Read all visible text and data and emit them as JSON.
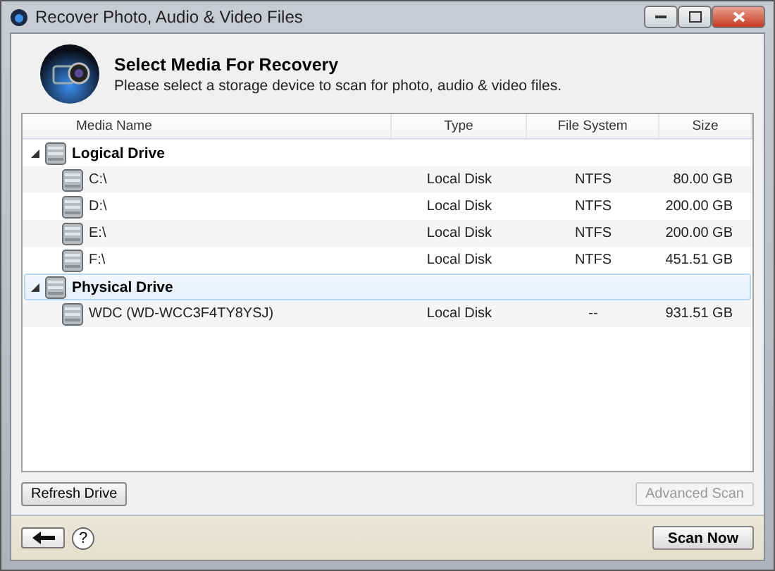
{
  "window": {
    "title": "Recover Photo, Audio & Video Files"
  },
  "header": {
    "title": "Select Media For Recovery",
    "subtitle": "Please select a storage device to scan for photo, audio & video files."
  },
  "table": {
    "columns": [
      "Media Name",
      "Type",
      "File System",
      "Size"
    ],
    "groups": [
      {
        "name": "Logical Drive",
        "expanded": true,
        "selected": false,
        "children": [
          {
            "name": "C:\\",
            "type": "Local Disk",
            "file_system": "NTFS",
            "size": "80.00 GB"
          },
          {
            "name": "D:\\",
            "type": "Local Disk",
            "file_system": "NTFS",
            "size": "200.00 GB"
          },
          {
            "name": "E:\\",
            "type": "Local Disk",
            "file_system": "NTFS",
            "size": "200.00 GB"
          },
          {
            "name": "F:\\",
            "type": "Local Disk",
            "file_system": "NTFS",
            "size": "451.51 GB"
          }
        ]
      },
      {
        "name": "Physical Drive",
        "expanded": true,
        "selected": true,
        "children": [
          {
            "name": "WDC (WD-WCC3F4TY8YSJ)",
            "type": "Local Disk",
            "file_system": "--",
            "size": "931.51 GB"
          }
        ]
      }
    ]
  },
  "buttons": {
    "refresh": {
      "label": "Refresh Drive",
      "disabled": false
    },
    "advanced": {
      "label": "Advanced Scan",
      "disabled": true
    }
  },
  "footer": {
    "help": "?",
    "scan": "Scan Now"
  }
}
